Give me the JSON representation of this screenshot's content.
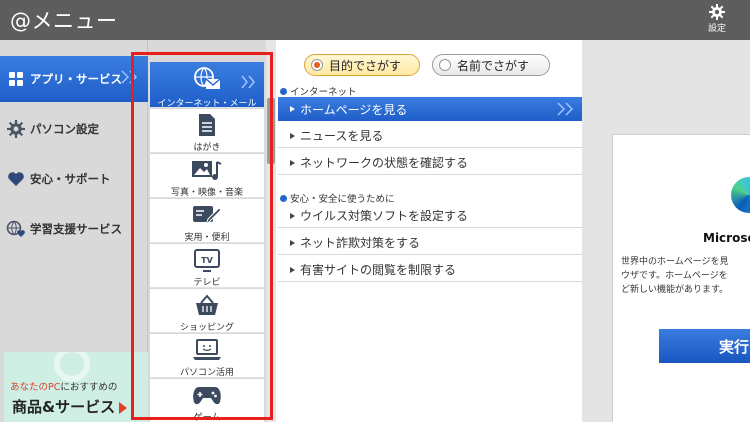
{
  "app": {
    "title": "@メニュー"
  },
  "header": {
    "settings_label": "設定"
  },
  "sidebar": {
    "items": [
      {
        "label": "アプリ・サービス",
        "icon": "grid-icon",
        "active": true
      },
      {
        "label": "パソコン設定",
        "icon": "gear-icon",
        "active": false
      },
      {
        "label": "安心・サポート",
        "icon": "heart-icon",
        "active": false
      },
      {
        "label": "学習支援サービス",
        "icon": "globe-heart-icon",
        "active": false
      }
    ],
    "banner": {
      "line1_accent": "あなたのPC",
      "line1_rest": "におすすめの",
      "line2": "商品&サービス"
    }
  },
  "categories": [
    {
      "label": "インターネット・メール",
      "icon": "globe-mail-icon",
      "active": true
    },
    {
      "label": "はがき",
      "icon": "document-icon",
      "active": false
    },
    {
      "label": "写真・映像・音楽",
      "icon": "photo-music-icon",
      "active": false
    },
    {
      "label": "実用・便利",
      "icon": "card-pen-icon",
      "active": false
    },
    {
      "label": "テレビ",
      "icon": "tv-icon",
      "active": false
    },
    {
      "label": "ショッピング",
      "icon": "basket-icon",
      "active": false
    },
    {
      "label": "パソコン活用",
      "icon": "laptop-icon",
      "active": false
    },
    {
      "label": "ゲーム",
      "icon": "gamepad-icon",
      "active": false
    }
  ],
  "search_modes": [
    {
      "label": "目的でさがす",
      "selected": true
    },
    {
      "label": "名前でさがす",
      "selected": false
    }
  ],
  "sections": [
    {
      "title": "インターネット",
      "items": [
        "ホームページを見る",
        "ニュースを見る",
        "ネットワークの状態を確認する"
      ]
    },
    {
      "title": "安心・安全に使うために",
      "items": [
        "ウイルス対策ソフトを設定する",
        "ネット詐欺対策をする",
        "有害サイトの閲覧を制限する"
      ]
    }
  ],
  "right_panel": {
    "title": "Microso",
    "desc": [
      "世界中のホームページを見",
      "ウザです。ホームページを",
      "ど新しい機能があります。"
    ],
    "button_label": "実行"
  },
  "colors": {
    "accent_blue": "#2a6fd6",
    "highlight_red": "#e8201c",
    "titlebar": "#5d5d5d"
  }
}
